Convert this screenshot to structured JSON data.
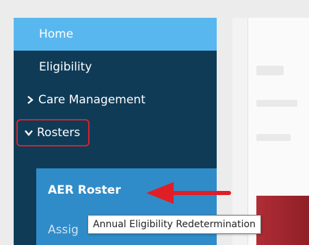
{
  "sidebar": {
    "items": [
      {
        "label": "Home"
      },
      {
        "label": "Eligibility"
      },
      {
        "label": "Care Management",
        "icon": "chevron-right-icon"
      },
      {
        "label": "Rosters",
        "icon": "chevron-down-icon"
      }
    ],
    "subitems": [
      {
        "label": "AER Roster"
      },
      {
        "label": "Assig"
      }
    ]
  },
  "tooltip": {
    "text": "Annual Eligibility Redetermination"
  },
  "colors": {
    "sidebar_bg": "#0f3b57",
    "home_bg": "#59b7ef",
    "subnav_bg": "#2f8cc9",
    "highlight_red": "#e0202a"
  }
}
